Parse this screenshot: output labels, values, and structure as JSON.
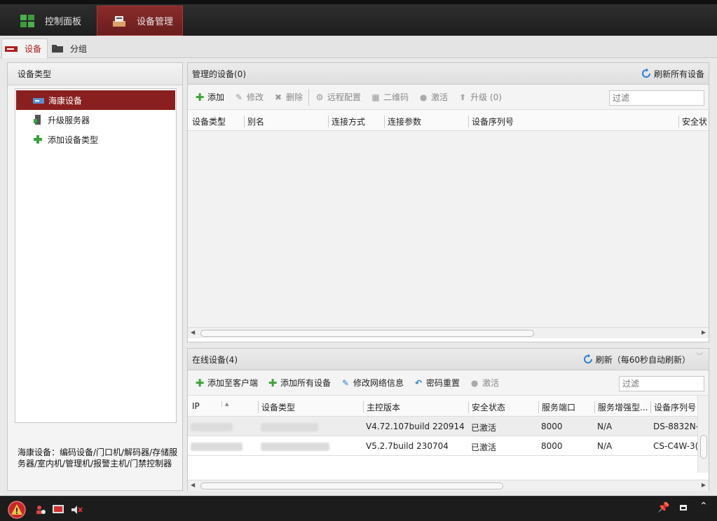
{
  "top_tabs": [
    {
      "label": "控制面板",
      "icon": "grid-icon"
    },
    {
      "label": "设备管理",
      "icon": "device-manage-icon"
    }
  ],
  "sub_tabs": [
    {
      "label": "设备",
      "icon": "device-icon"
    },
    {
      "label": "分组",
      "icon": "folder-icon"
    }
  ],
  "left": {
    "title": "设备类型",
    "items": [
      {
        "label": "海康设备",
        "icon": "hik-device-icon",
        "selected": true
      },
      {
        "label": "升级服务器",
        "icon": "server-icon"
      },
      {
        "label": "添加设备类型",
        "icon": "plus-icon"
      }
    ],
    "description": "海康设备：编码设备/门口机/解码器/存储服务器/室内机/管理机/报警主机/门禁控制器"
  },
  "managed": {
    "title": "管理的设备(0)",
    "refresh_label": "刷新所有设备",
    "toolbar": {
      "add": "添加",
      "edit": "修改",
      "delete": "删除",
      "remote_config": "远程配置",
      "qrcode": "二维码",
      "activate": "激活",
      "upgrade": "升级 (0)"
    },
    "filter_placeholder": "过滤",
    "columns": [
      "设备类型",
      "别名",
      "连接方式",
      "连接参数",
      "设备序列号",
      "安全状"
    ]
  },
  "online": {
    "title": "在线设备(4)",
    "refresh_label": "刷新（每60秒自动刷新）",
    "toolbar": {
      "add_to_client": "添加至客户端",
      "add_all": "添加所有设备",
      "modify_net": "修改网络信息",
      "reset_pwd": "密码重置",
      "activate": "激活"
    },
    "filter_placeholder": "过滤",
    "columns": [
      "IP",
      "设备类型",
      "主控版本",
      "安全状态",
      "服务端口",
      "服务增强型...",
      "设备序列号"
    ],
    "rows": [
      {
        "ip": "",
        "type": "",
        "version": "V4.72.107build 220914",
        "security": "已激活",
        "port": "8000",
        "enhanced": "N/A",
        "serial": "DS-8832N-"
      },
      {
        "ip": "",
        "type": "",
        "version": "V5.2.7build 230704",
        "security": "已激活",
        "port": "8000",
        "enhanced": "N/A",
        "serial": "CS-C4W-3("
      }
    ]
  },
  "colors": {
    "accent": "#8a1f1f",
    "green": "#3aa23a",
    "blue": "#2a7fd4"
  }
}
